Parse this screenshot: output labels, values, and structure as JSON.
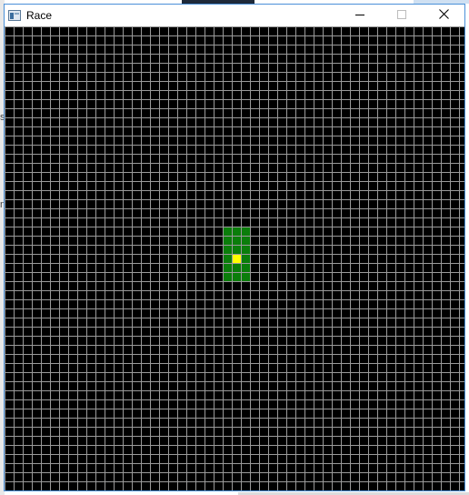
{
  "window": {
    "title": "Race",
    "buttons": {
      "minimize_icon": "minimize-icon",
      "maximize_icon": "maximize-icon",
      "close_icon": "close-icon"
    }
  },
  "desktop": {
    "left_chars": [
      "s",
      "n"
    ]
  },
  "board": {
    "columns": 50,
    "rows": 50,
    "background_color": "#000000",
    "grid_line_color": "#9a9a9a",
    "highlight_color": "#0a7d0a",
    "player_color": "#ffff00",
    "highlight_cells": {
      "col_start": 24,
      "col_end": 26,
      "row_start": 22,
      "row_end": 27
    },
    "player_cell": {
      "col": 25,
      "row": 25
    }
  }
}
